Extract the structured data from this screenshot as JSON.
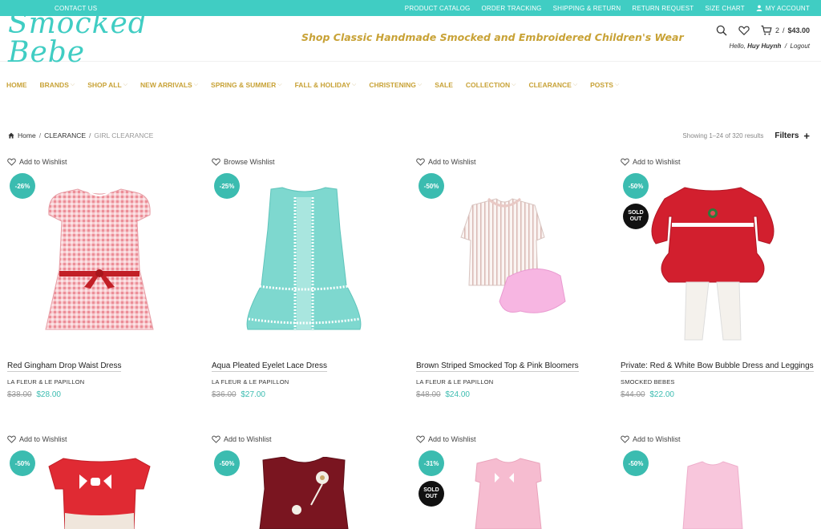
{
  "topbar": {
    "contact": "CONTACT US",
    "links": [
      "PRODUCT CATALOG",
      "ORDER TRACKING",
      "SHIPPING & RETURN",
      "RETURN REQUEST",
      "SIZE CHART"
    ],
    "account": "MY ACCOUNT"
  },
  "header": {
    "logo": "Smocked Bebe",
    "tagline": "Shop Classic Handmade Smocked and Embroidered Children's Wear",
    "cart_count": "2",
    "cart_sep": "/",
    "cart_total": "$43.00",
    "hello_prefix": "Hello,",
    "user_name": "Huy Huynh",
    "logout_sep": "/",
    "logout": "Logout"
  },
  "nav": {
    "items": [
      {
        "label": "HOME",
        "chevron": false
      },
      {
        "label": "BRANDS",
        "chevron": true
      },
      {
        "label": "SHOP ALL",
        "chevron": true
      },
      {
        "label": "NEW ARRIVALS",
        "chevron": true
      },
      {
        "label": "SPRING & SUMMER",
        "chevron": true
      },
      {
        "label": "FALL & HOLIDAY",
        "chevron": true
      },
      {
        "label": "CHRISTENING",
        "chevron": true
      },
      {
        "label": "SALE",
        "chevron": false
      },
      {
        "label": "COLLECTION",
        "chevron": true
      },
      {
        "label": "CLEARANCE",
        "chevron": true
      },
      {
        "label": "POSTS",
        "chevron": true
      }
    ]
  },
  "breadcrumb": {
    "home": "Home",
    "sep": "/",
    "level1": "CLEARANCE",
    "current": "GIRL CLEARANCE"
  },
  "results": {
    "count": "Showing 1–24 of 320 results",
    "filters": "Filters",
    "plus": "+"
  },
  "products": [
    {
      "wishlist": "Add to Wishlist",
      "discount": "-26%",
      "sold_out": "",
      "name": "Red Gingham Drop Waist Dress",
      "brand": "LA FLEUR & LE PAPILLON",
      "old_price": "$38.00",
      "price": "$28.00"
    },
    {
      "wishlist": "Browse Wishlist",
      "discount": "-25%",
      "sold_out": "",
      "name": "Aqua Pleated Eyelet Lace Dress",
      "brand": "LA FLEUR & LE PAPILLON",
      "old_price": "$36.00",
      "price": "$27.00"
    },
    {
      "wishlist": "Add to Wishlist",
      "discount": "-50%",
      "sold_out": "",
      "name": "Brown Striped Smocked Top & Pink Bloomers",
      "brand": "LA FLEUR & LE PAPILLON",
      "old_price": "$48.00",
      "price": "$24.00"
    },
    {
      "wishlist": "Add to Wishlist",
      "discount": "-50%",
      "sold_out": "SOLD OUT",
      "name": "Private: Red & White Bow Bubble Dress and Leggings",
      "brand": "SMOCKED BEBES",
      "old_price": "$44.00",
      "price": "$22.00"
    },
    {
      "wishlist": "Add to Wishlist",
      "discount": "-50%",
      "sold_out": ""
    },
    {
      "wishlist": "Add to Wishlist",
      "discount": "-50%",
      "sold_out": ""
    },
    {
      "wishlist": "Add to Wishlist",
      "discount": "-31%",
      "sold_out": "SOLD OUT"
    },
    {
      "wishlist": "Add to Wishlist",
      "discount": "-50%",
      "sold_out": ""
    }
  ],
  "colors": {
    "accent": "#40cdc3",
    "badge": "#3bbcb0",
    "gold": "#c8a236"
  }
}
